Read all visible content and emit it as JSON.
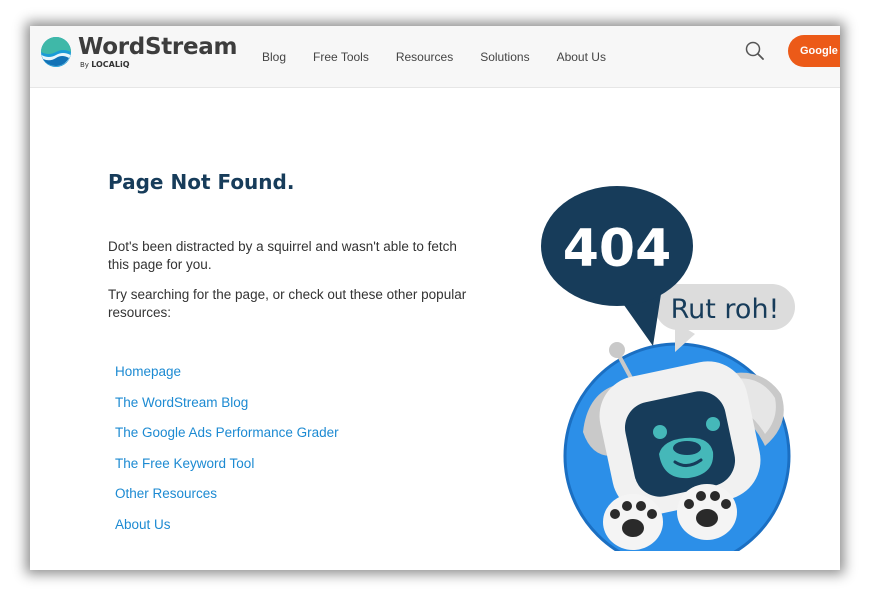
{
  "brand": {
    "name": "WordStream",
    "by_label": "By",
    "by_brand": "LOCALiQ"
  },
  "nav": {
    "items": [
      "Blog",
      "Free Tools",
      "Resources",
      "Solutions",
      "About Us"
    ],
    "search_icon": "magnifier-icon",
    "cta_label": "Google Ads"
  },
  "main": {
    "title": "Page Not Found.",
    "paragraph1": "Dot's been distracted by a squirrel and wasn't able to fetch this page for you.",
    "paragraph2": "Try searching for the page, or check out these other popular resources:",
    "links": [
      "Homepage",
      "The WordStream Blog",
      "The Google Ads Performance Grader",
      "The Free Keyword Tool",
      "Other Resources",
      "About Us"
    ]
  },
  "illustration": {
    "bubble_code": "404",
    "bubble_text": "Rut roh!"
  },
  "colors": {
    "navy": "#173c5a",
    "link": "#1c8ad2",
    "cta": "#ec5a18",
    "robot_blue": "#2c8fe8",
    "teal": "#45b8b9"
  }
}
